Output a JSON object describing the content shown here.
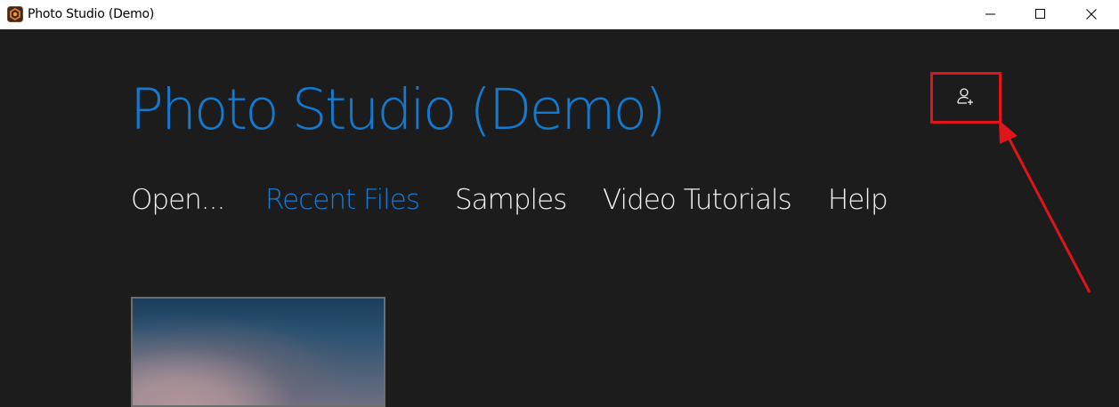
{
  "window": {
    "title": "Photo Studio (Demo)",
    "icon": "app-logo-icon",
    "controls": [
      "minimize-icon",
      "maximize-icon",
      "close-icon"
    ]
  },
  "header": {
    "title": "Photo Studio (Demo)",
    "title_color": "#1379d1",
    "add_user_icon": "user-add-icon"
  },
  "nav": {
    "items": [
      {
        "label": "Open..."
      },
      {
        "label": "Recent Files",
        "active": true
      },
      {
        "label": "Samples"
      },
      {
        "label": "Video Tutorials"
      },
      {
        "label": "Help"
      }
    ],
    "active_color": "#1a79d1"
  },
  "recent_files": {
    "thumbnails": [
      "sky-photo-thumbnail"
    ]
  },
  "annotation": {
    "color": "#e0141a",
    "target": "user-add-button"
  }
}
